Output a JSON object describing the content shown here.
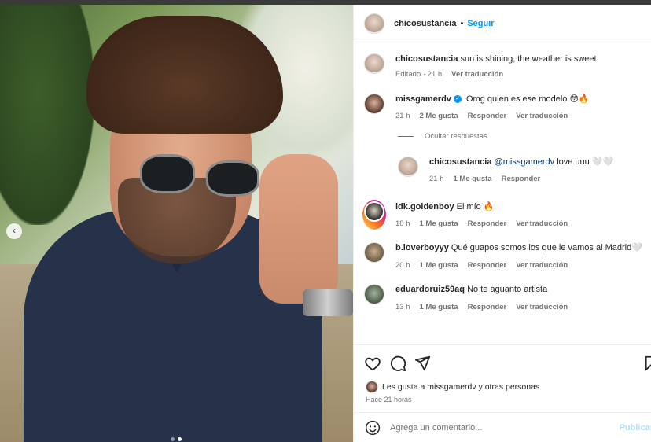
{
  "post": {
    "author": "chicosustancia",
    "follow_label": "Seguir",
    "caption_user": "chicosustancia",
    "caption_text": "sun is shining, the weather is sweet",
    "caption_meta_edited": "Editado · 21 h",
    "caption_meta_translate": "Ver traducción",
    "carousel_count": 2,
    "carousel_active": 2
  },
  "comments": [
    {
      "user": "missgamerdv",
      "verified": true,
      "text": "Omg quien es ese modelo 😳🔥",
      "time": "21 h",
      "likes": "2 Me gusta",
      "reply": "Responder",
      "translate": "Ver traducción"
    },
    {
      "user": "idk.goldenboy",
      "text": "El mío 🔥",
      "time": "18 h",
      "likes": "1 Me gusta",
      "reply": "Responder",
      "translate": "Ver traducción"
    },
    {
      "user": "b.loverboyyy",
      "text": "Qué guapos somos los que le vamos al Madrid🤍",
      "time": "20 h",
      "likes": "1 Me gusta",
      "reply": "Responder",
      "translate": "Ver traducción"
    },
    {
      "user": "eduardoruiz59aq",
      "text": "No te aguanto artista",
      "time": "13 h",
      "likes": "1 Me gusta",
      "reply": "Responder",
      "translate": "Ver traducción"
    }
  ],
  "hide_replies": "Ocultar respuestas",
  "reply": {
    "user": "chicosustancia",
    "mention": "@missgamerdv",
    "text": "love uuu 🤍🤍",
    "time": "21 h",
    "likes": "1 Me gusta",
    "reply": "Responder"
  },
  "likes_summary": "Les gusta a missgamerdv y otras personas",
  "timestamp": "Hace 21 horas",
  "composer": {
    "placeholder": "Agrega un comentario...",
    "publish": "Publicar"
  },
  "icons": [
    "heart-icon",
    "comment-icon",
    "share-icon",
    "bookmark-icon",
    "emoji-icon",
    "chevron-left-icon"
  ],
  "colors": {
    "accent": "#0095f6",
    "text": "#262626",
    "muted": "#737373"
  }
}
